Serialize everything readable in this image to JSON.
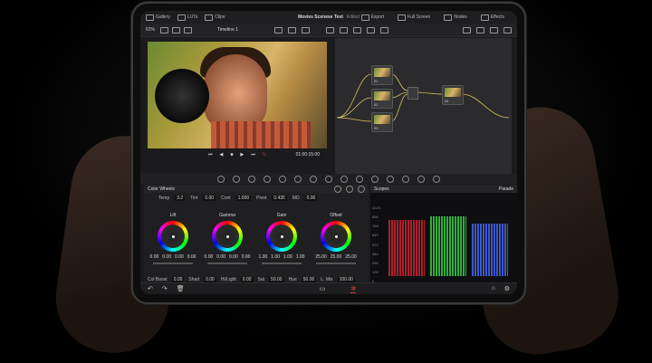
{
  "topbar": {
    "gallery": "Gallery",
    "luts": "LUTs",
    "clips": "Clips",
    "title": "Movies Scenese Test",
    "edited": "Edited",
    "export": "Export",
    "full_screen": "Full Screen",
    "nodes": "Nodes",
    "effects": "Effects"
  },
  "toolbar": {
    "zoom": "62%",
    "timeline": "Timeline 1"
  },
  "viewer": {
    "timecode": "01:00:15:00"
  },
  "node_graph": {
    "nodes": [
      "01",
      "02",
      "03",
      "04"
    ]
  },
  "color_wheels": {
    "header": "Color Wheels",
    "params": [
      {
        "label": "Temp",
        "value": "3.2"
      },
      {
        "label": "Tint",
        "value": "0.00"
      },
      {
        "label": "Cont",
        "value": "1.000"
      },
      {
        "label": "Pivot",
        "value": "0.435"
      },
      {
        "label": "MD",
        "value": "0.00"
      }
    ],
    "wheels": [
      {
        "name": "Lift",
        "vals": [
          "0.00",
          "0.00",
          "0.00",
          "0.00"
        ]
      },
      {
        "name": "Gamma",
        "vals": [
          "0.00",
          "0.00",
          "0.00",
          "0.00"
        ]
      },
      {
        "name": "Gain",
        "vals": [
          "1.00",
          "1.00",
          "1.00",
          "1.00"
        ]
      },
      {
        "name": "Offset",
        "vals": [
          "25.00",
          "25.00",
          "25.00"
        ]
      }
    ],
    "bottom_params": [
      {
        "label": "Col Boost",
        "value": "0.00"
      },
      {
        "label": "Shad",
        "value": "0.00"
      },
      {
        "label": "Hi/Light",
        "value": "0.00"
      },
      {
        "label": "Sat",
        "value": "50.00"
      },
      {
        "label": "Hue",
        "value": "50.00"
      },
      {
        "label": "L. Mix",
        "value": "100.00"
      }
    ]
  },
  "scopes": {
    "header": "Scopes",
    "mode": "Parade",
    "axis": [
      "1023",
      "896",
      "768",
      "640",
      "512",
      "384",
      "256",
      "128",
      "0"
    ]
  },
  "colors": {
    "accent": "#e33333",
    "panel": "#1b1b1d"
  }
}
